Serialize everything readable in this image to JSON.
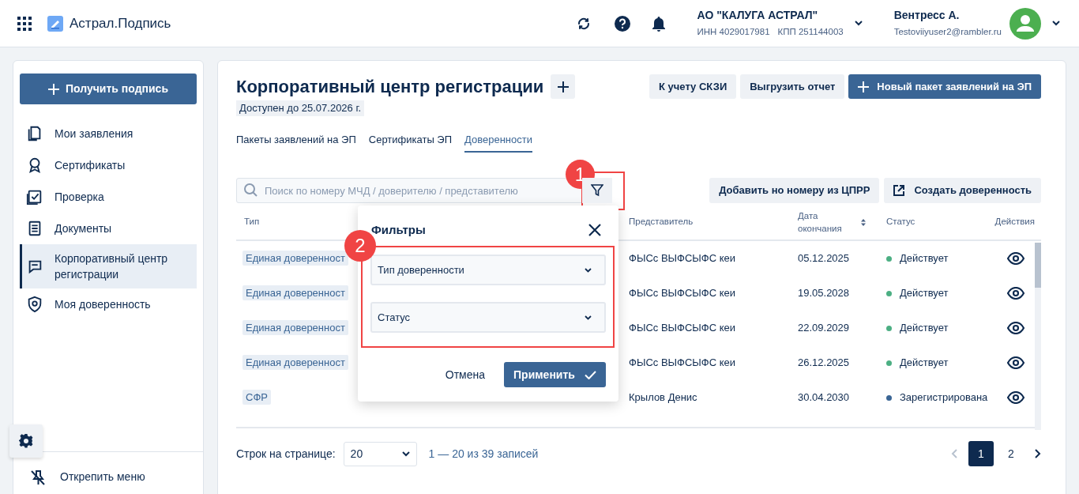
{
  "header": {
    "app_name": "Астрал.Подпись",
    "company": {
      "name": "АО \"КАЛУГА АСТРАЛ\"",
      "inn": "ИНН 4029017981",
      "kpp": "КПП 251144003"
    },
    "user": {
      "name": "Вентресс А.",
      "email": "Testoviiyuser2@rambler.ru"
    }
  },
  "sidebar": {
    "primary_button": "Получить подпись",
    "items": [
      {
        "kind": "applications",
        "label": "Мои заявления",
        "selected": false
      },
      {
        "kind": "certificates",
        "label": "Сертификаты",
        "selected": false
      },
      {
        "kind": "check",
        "label": "Проверка",
        "selected": false
      },
      {
        "kind": "documents",
        "label": "Документы",
        "selected": false
      },
      {
        "kind": "center",
        "label": "Корпоративный центр регистрации",
        "selected": true
      },
      {
        "kind": "poa",
        "label": "Моя доверенность",
        "selected": false
      }
    ],
    "unpin_label": "Открепить меню"
  },
  "page": {
    "title": "Корпоративный центр регистрации",
    "availability": "Доступен до 25.07.2026 г.",
    "header_buttons": [
      {
        "kind": "plain",
        "label": "К учету СКЗИ"
      },
      {
        "kind": "plain",
        "label": "Выгрузить отчет"
      },
      {
        "kind": "primary",
        "label": "Новый пакет заявлений на ЭП"
      }
    ],
    "tabs": [
      {
        "label": "Пакеты заявлений на ЭП",
        "selected": false
      },
      {
        "label": "Сертификаты ЭП",
        "selected": false
      },
      {
        "label": "Доверенности",
        "selected": true
      }
    ],
    "search": {
      "placeholder": "Поиск по номеру МЧД / доверителю / представителю"
    },
    "action_buttons": [
      {
        "kind": "plain",
        "label": "Добавить но номеру из ЦПРР"
      },
      {
        "kind": "external",
        "label": "Создать доверенность"
      }
    ],
    "table": {
      "columns": [
        {
          "label": "Тип",
          "sortable": false
        },
        {
          "label": "Представитель",
          "sortable": false
        },
        {
          "label": "Дата окончания",
          "sortable": true
        },
        {
          "label": "Статус",
          "sortable": false
        },
        {
          "label": "Действия",
          "sortable": false
        }
      ],
      "rows": [
        {
          "type": "Единая доверенност",
          "representative": "ФЫСс ВЫФСЫФС кеи",
          "end_date": "05.12.2025",
          "status": "Действует",
          "color": "#4caf83"
        },
        {
          "type": "Единая доверенност",
          "representative": "ФЫСс ВЫФСЫФС кеи",
          "end_date": "19.05.2028",
          "status": "Действует",
          "color": "#4caf83"
        },
        {
          "type": "Единая доверенност",
          "representative": "ФЫСс ВЫФСЫФС кеи",
          "end_date": "22.09.2029",
          "status": "Действует",
          "color": "#4caf83"
        },
        {
          "type": "Единая доверенност",
          "representative": "ФЫСс ВЫФСЫФС кеи",
          "end_date": "26.12.2025",
          "status": "Действует",
          "color": "#4caf83"
        },
        {
          "type": "СФР",
          "representative": "Крылов Денис",
          "end_date": "30.04.2030",
          "status": "Зарегистрирована",
          "color": "#3a6595"
        }
      ]
    },
    "pagination": {
      "rows_label": "Строк на странице:",
      "rows_value": "20",
      "range": "1 — 20 из 39 записей",
      "pages": [
        {
          "label": "1",
          "selected": true
        },
        {
          "label": "2",
          "selected": false
        }
      ]
    }
  },
  "filter_popup": {
    "title": "Фильтры",
    "fields": [
      {
        "placeholder": "Тип доверенности"
      },
      {
        "placeholder": "Статус"
      }
    ],
    "cancel": "Отмена",
    "apply": "Применить"
  },
  "annotations": [
    {
      "label": "1"
    },
    {
      "label": "2"
    }
  ]
}
